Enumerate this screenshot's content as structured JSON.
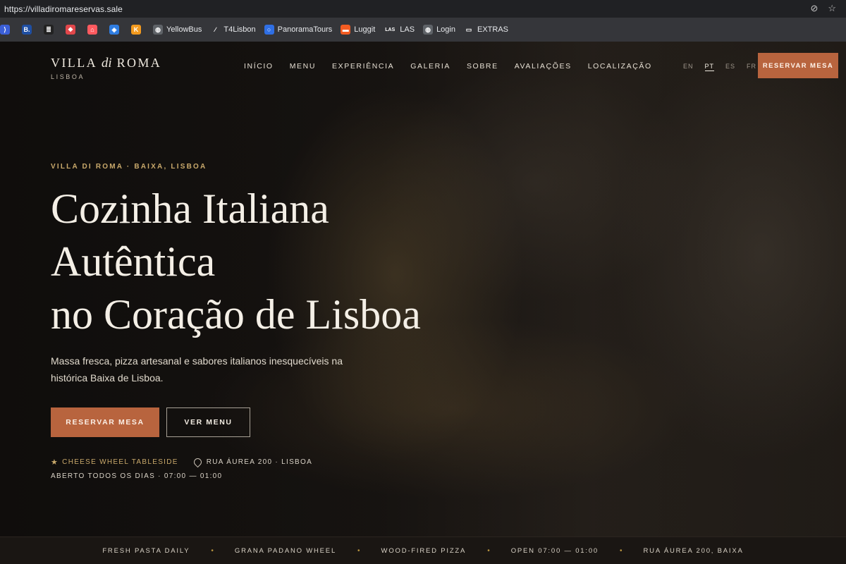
{
  "browser": {
    "url": "https://villadiromareservas.sale",
    "bookmarks": [
      {
        "label": "",
        "color": "#3b5fd8",
        "glyph": "⟩"
      },
      {
        "label": "",
        "color": "#1f4fa3",
        "glyph": "B."
      },
      {
        "label": "",
        "color": "#222222",
        "glyph": "≣"
      },
      {
        "label": "",
        "color": "#e2474b",
        "glyph": "❖"
      },
      {
        "label": "",
        "color": "#ff5a5f",
        "glyph": "⌂"
      },
      {
        "label": "",
        "color": "#2f7de1",
        "glyph": "◈"
      },
      {
        "label": "",
        "color": "#f39a1e",
        "glyph": "K"
      },
      {
        "label": "YellowBus",
        "color": "#5f6368",
        "glyph": "◍"
      },
      {
        "label": "T4Lisbon",
        "color": "#35363a",
        "glyph": "∕"
      },
      {
        "label": "PanoramaTours",
        "color": "#2f6fe4",
        "glyph": "○"
      },
      {
        "label": "Luggit",
        "color": "#f25c22",
        "glyph": "▬"
      },
      {
        "label": "LAS",
        "color": "#35363a",
        "glyph": "LAS"
      },
      {
        "label": "Login",
        "color": "#5f6368",
        "glyph": "◍"
      },
      {
        "label": "EXTRAS",
        "color": "#35363a",
        "glyph": "▭"
      }
    ]
  },
  "header": {
    "logo_prefix": "VILLA",
    "logo_italic": "di",
    "logo_suffix": "ROMA",
    "logo_city": "LISBOA",
    "nav": [
      "INÍCIO",
      "MENU",
      "EXPERIÊNCIA",
      "GALERIA",
      "SOBRE",
      "AVALIAÇÕES",
      "LOCALIZAÇÃO"
    ],
    "languages": [
      "EN",
      "PT",
      "ES",
      "FR"
    ],
    "active_language": "PT",
    "reserve_label": "RESERVAR MESA"
  },
  "hero": {
    "eyebrow": "VILLA DI ROMA · BAIXA, LISBOA",
    "headline_lines": [
      "Cozinha Italiana",
      "Autêntica",
      "no Coração de Lisboa"
    ],
    "subtitle": "Massa fresca, pizza artesanal e sabores italianos inesquecíveis na histórica Baixa de Lisboa.",
    "primary_cta": "RESERVAR MESA",
    "secondary_cta": "VER MENU",
    "feature": "CHEESE WHEEL TABLESIDE",
    "address": "RUA ÁUREA 200 · LISBOA",
    "hours": "ABERTO TODOS OS DIAS · 07:00 — 01:00"
  },
  "ticker": [
    "FRESH PASTA DAILY",
    "GRANA PADANO WHEEL",
    "WOOD-FIRED PIZZA",
    "OPEN 07:00 — 01:00",
    "RUA ÁUREA 200, BAIXA"
  ],
  "colors": {
    "accent": "#b8643e",
    "gold": "#c9a96b",
    "background": "#1c1714"
  }
}
